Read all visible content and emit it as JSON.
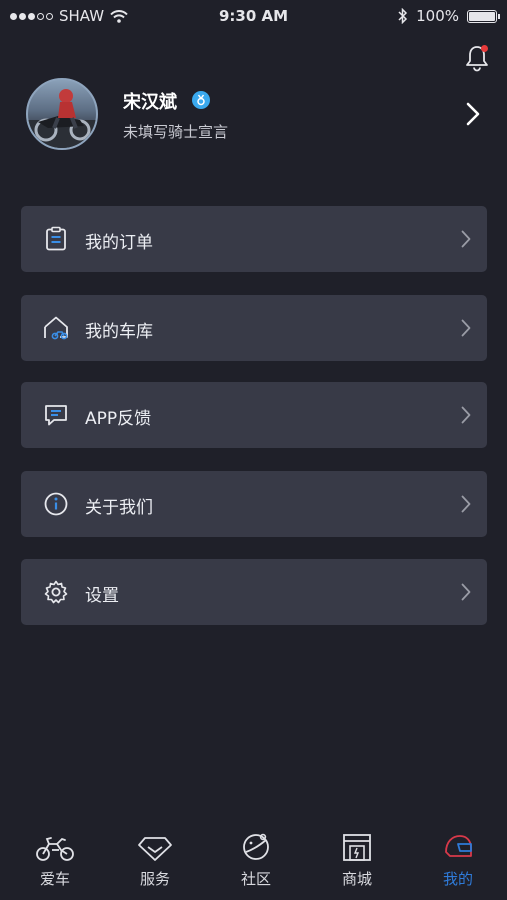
{
  "status_bar": {
    "carrier": "SHAW",
    "time": "9:30 AM",
    "battery": "100%"
  },
  "profile": {
    "name": "宋汉斌",
    "badge": "♁",
    "motto": "未填写骑士宣言"
  },
  "menu": [
    {
      "label": "我的订单",
      "icon": "clipboard-icon"
    },
    {
      "label": "我的车库",
      "icon": "garage-icon"
    },
    {
      "label": "APP反馈",
      "icon": "feedback-icon"
    },
    {
      "label": "关于我们",
      "icon": "info-icon"
    },
    {
      "label": "设置",
      "icon": "gear-icon"
    }
  ],
  "tabs": [
    {
      "label": "爱车",
      "icon": "motorcycle-icon"
    },
    {
      "label": "服务",
      "icon": "diamond-icon"
    },
    {
      "label": "社区",
      "icon": "planet-icon"
    },
    {
      "label": "商城",
      "icon": "store-icon"
    },
    {
      "label": "我的",
      "icon": "helmet-icon",
      "active": true
    }
  ],
  "colors": {
    "background": "#1f2029",
    "card": "#383a47",
    "accent": "#2f7bd9",
    "notification": "#e83a3a"
  }
}
